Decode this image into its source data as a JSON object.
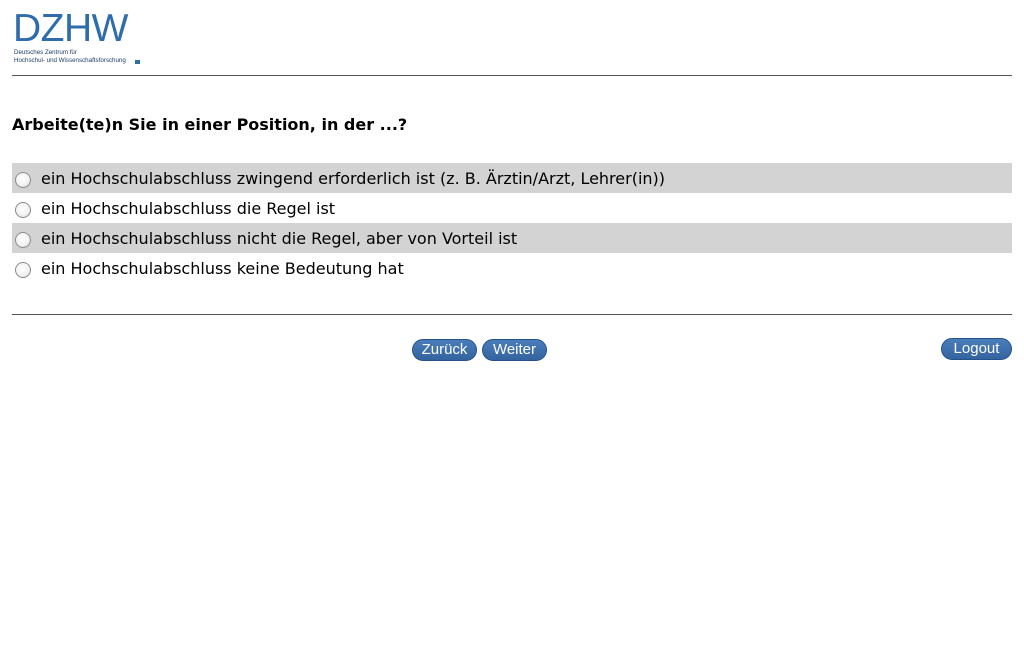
{
  "logo": {
    "wordmark": "DZHW",
    "subtitle_line1": "Deutsches Zentrum für",
    "subtitle_line2": "Hochschul- und Wissenschaftsforschung"
  },
  "question": {
    "text": "Arbeite(te)n Sie in einer Position, in der ...?"
  },
  "options": [
    {
      "label": "ein Hochschulabschluss zwingend erforderlich ist (z. B. Ärztin/Arzt, Lehrer(in))",
      "selected": false
    },
    {
      "label": "ein Hochschulabschluss die Regel ist",
      "selected": false
    },
    {
      "label": "ein Hochschulabschluss nicht die Regel, aber von Vorteil ist",
      "selected": false
    },
    {
      "label": "ein Hochschulabschluss keine Bedeutung hat",
      "selected": false
    }
  ],
  "navigation": {
    "back_label": "Zurück",
    "next_label": "Weiter",
    "logout_label": "Logout"
  },
  "colors": {
    "brand": "#2e6cab",
    "button": "#3a6aa8",
    "row_shade": "#d3d3d3"
  }
}
